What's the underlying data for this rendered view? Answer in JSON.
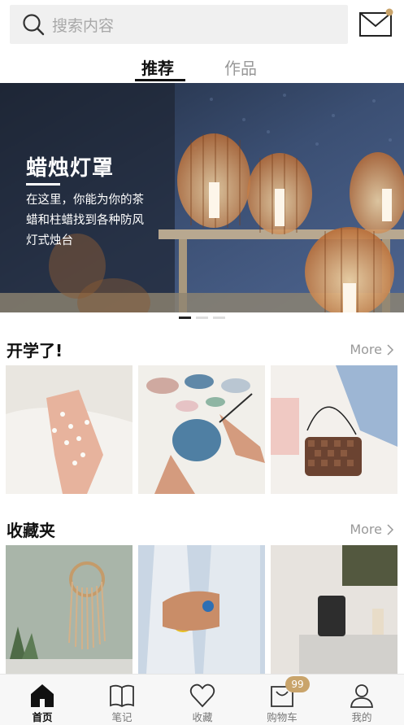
{
  "search": {
    "placeholder": "搜索内容"
  },
  "tabs": [
    {
      "label": "推荐",
      "active": true
    },
    {
      "label": "作品",
      "active": false
    }
  ],
  "banner": {
    "title": "蜡烛灯罩",
    "description": "在这里，你能为你的茶蜡和柱蜡找到各种防风灯式烛台",
    "slides": 3,
    "active_slide": 1
  },
  "sections": [
    {
      "title": "开学了!",
      "more_label": "More"
    },
    {
      "title": "收藏夹",
      "more_label": "More"
    }
  ],
  "bottom_nav": [
    {
      "label": "首页",
      "icon": "home-icon",
      "active": true
    },
    {
      "label": "笔记",
      "icon": "book-icon",
      "active": false
    },
    {
      "label": "收藏",
      "icon": "heart-icon",
      "active": false
    },
    {
      "label": "购物车",
      "icon": "cart-icon",
      "active": false,
      "badge": "99"
    },
    {
      "label": "我的",
      "icon": "profile-icon",
      "active": false
    }
  ],
  "colors": {
    "accent": "#c9a46b",
    "text": "#111111",
    "muted": "#999999"
  }
}
